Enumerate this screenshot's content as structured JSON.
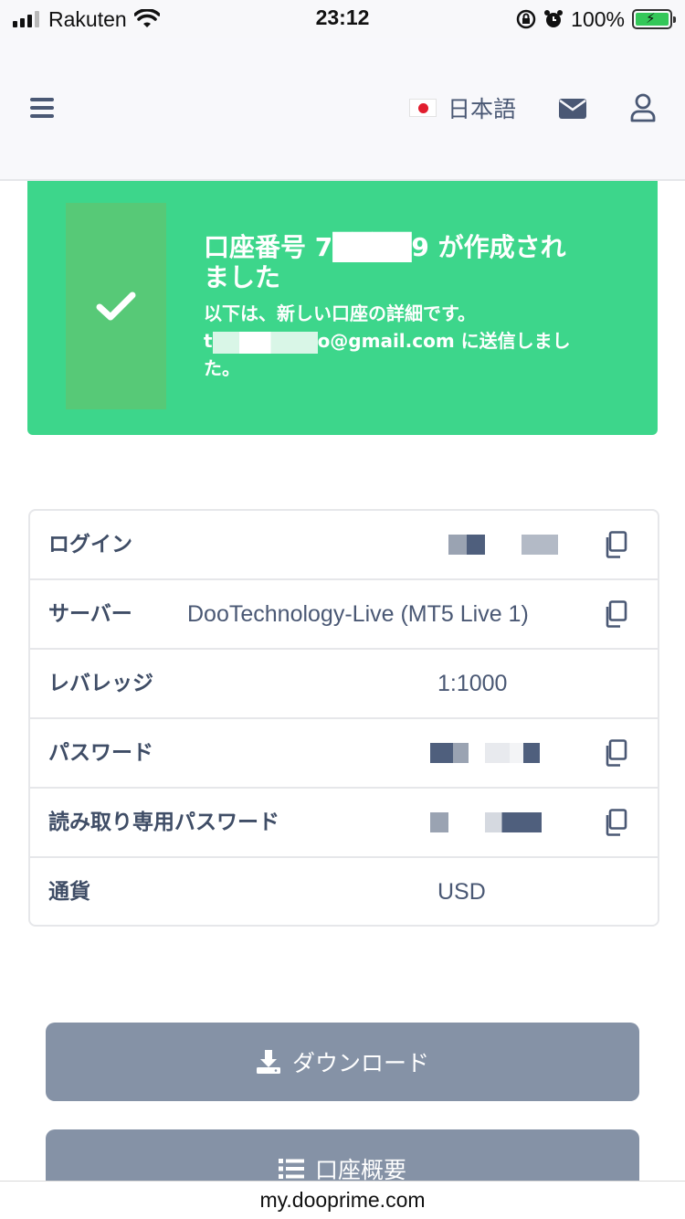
{
  "status_bar": {
    "carrier": "Rakuten",
    "time": "23:12",
    "battery": "100%"
  },
  "header": {
    "language": "日本語",
    "icons": [
      "menu-icon",
      "flag-icon",
      "mail-icon",
      "user-icon"
    ]
  },
  "banner": {
    "title": "口座番号 7████9 が作成されました",
    "message_line1": "以下は、新しい口座の詳細です。",
    "email_prefix": "t",
    "email_suffix": "o@gmail.com に送信しました。",
    "icon": "check-icon"
  },
  "details": {
    "rows": [
      {
        "label": "ログイン",
        "value": "",
        "copyable": true
      },
      {
        "label": "サーバー",
        "value": "DooTechnology-Live (MT5 Live 1)",
        "copyable": true
      },
      {
        "label": "レバレッジ",
        "value": "1:1000",
        "copyable": false
      },
      {
        "label": "パスワード",
        "value": "",
        "copyable": true
      },
      {
        "label": "読み取り専用パスワード",
        "value": "",
        "copyable": true
      },
      {
        "label": "通貨",
        "value": "USD",
        "copyable": false
      }
    ]
  },
  "buttons": {
    "download": "ダウンロード",
    "overview": "口座概要"
  },
  "url": "my.dooprime.com",
  "colors": {
    "banner": "#3dd68b",
    "button": "#8592a6",
    "text": "#4a5874"
  }
}
